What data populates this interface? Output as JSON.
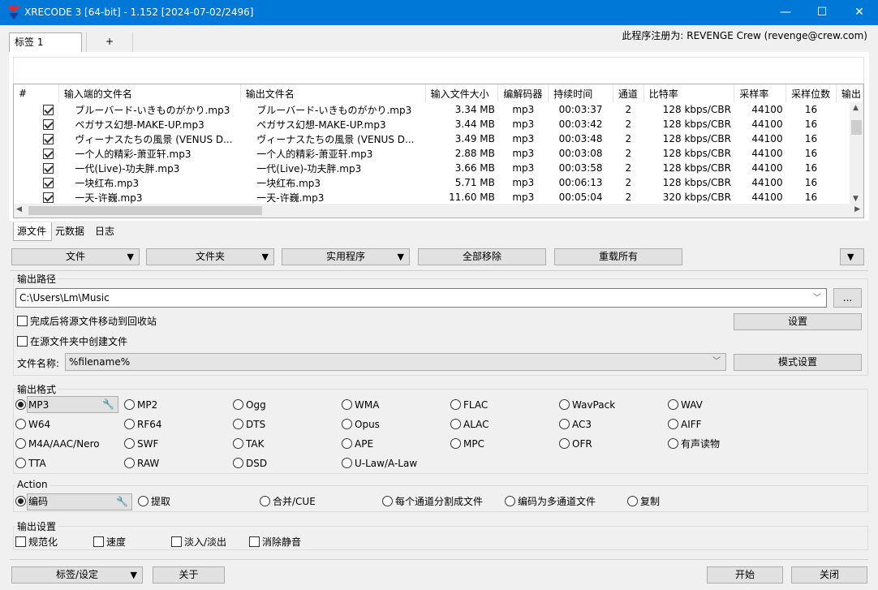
{
  "window": {
    "title": "XRECODE 3 [64-bit] - 1.152 [2024-07-02/2496]",
    "minimize": "—",
    "maximize": "☐",
    "close": "✕"
  },
  "top_tabs": {
    "tab1": "标签 1",
    "add": "+"
  },
  "registration": "此程序注册为: REVENGE Crew (revenge@crew.com)",
  "file_list": {
    "columns": [
      "#",
      "输入端的文件名",
      "输出文件名",
      "输入文件大小",
      "编解码器",
      "持续时间",
      "通道",
      "比特率",
      "采样率",
      "采样位数",
      "输出"
    ],
    "rows": [
      {
        "in": "ブルーバード-いきものがかり.mp3",
        "out": "ブルーバード-いきものがかり.mp3",
        "size": "3.34 MB",
        "codec": "mp3",
        "dur": "00:03:37",
        "ch": "2",
        "br": "128 kbps/CBR",
        "sr": "44100",
        "bits": "16"
      },
      {
        "in": "ペガサス幻想-MAKE-UP.mp3",
        "out": "ペガサス幻想-MAKE-UP.mp3",
        "size": "3.44 MB",
        "codec": "mp3",
        "dur": "00:03:42",
        "ch": "2",
        "br": "128 kbps/CBR",
        "sr": "44100",
        "bits": "16"
      },
      {
        "in": "ヴィーナスたちの風景 (VENUS D...",
        "out": "ヴィーナスたちの風景 (VENUS D...",
        "size": "3.49 MB",
        "codec": "mp3",
        "dur": "00:03:48",
        "ch": "2",
        "br": "128 kbps/CBR",
        "sr": "44100",
        "bits": "16"
      },
      {
        "in": "一个人的精彩-萧亚轩.mp3",
        "out": "一个人的精彩-萧亚轩.mp3",
        "size": "2.88 MB",
        "codec": "mp3",
        "dur": "00:03:08",
        "ch": "2",
        "br": "128 kbps/CBR",
        "sr": "44100",
        "bits": "16"
      },
      {
        "in": "一代(Live)-功夫胖.mp3",
        "out": "一代(Live)-功夫胖.mp3",
        "size": "3.66 MB",
        "codec": "mp3",
        "dur": "00:03:58",
        "ch": "2",
        "br": "128 kbps/CBR",
        "sr": "44100",
        "bits": "16"
      },
      {
        "in": "一块红布.mp3",
        "out": "一块红布.mp3",
        "size": "5.71 MB",
        "codec": "mp3",
        "dur": "00:06:13",
        "ch": "2",
        "br": "128 kbps/CBR",
        "sr": "44100",
        "bits": "16"
      },
      {
        "in": "一天-许巍.mp3",
        "out": "一天-许巍.mp3",
        "size": "11.60 MB",
        "codec": "mp3",
        "dur": "00:05:04",
        "ch": "2",
        "br": "320 kbps/CBR",
        "sr": "44100",
        "bits": "16"
      }
    ]
  },
  "bottom_tabs": [
    "源文件",
    "元数据",
    "日志"
  ],
  "toolbar": {
    "file": "文件",
    "folder": "文件夹",
    "utility": "实用程序",
    "remove_all": "全部移除",
    "reload_all": "重载所有"
  },
  "output_path": {
    "label": "输出路径",
    "value": "C:\\Users\\Lm\\Music",
    "browse": "...",
    "move_to_recycle": "完成后将源文件移动到回收站",
    "settings": "设置",
    "create_in_source": "在源文件夹中创建文件",
    "filename_label": "文件名称:",
    "filename_value": "%filename%",
    "pattern_settings": "模式设置"
  },
  "output_format": {
    "label": "输出格式",
    "selected": "MP3",
    "options": [
      [
        "MP3",
        "MP2",
        "Ogg",
        "WMA",
        "FLAC",
        "WavPack",
        "WAV"
      ],
      [
        "W64",
        "RF64",
        "DTS",
        "Opus",
        "ALAC",
        "AC3",
        "AIFF"
      ],
      [
        "M4A/AAC/Nero",
        "SWF",
        "TAK",
        "APE",
        "MPC",
        "OFR",
        "有声读物"
      ],
      [
        "TTA",
        "RAW",
        "DSD",
        "U-Law/A-Law"
      ]
    ]
  },
  "action": {
    "label": "Action",
    "selected": "编码",
    "options": [
      "编码",
      "提取",
      "合并/CUE",
      "每个通道分割成文件",
      "编码为多通道文件",
      "复制"
    ]
  },
  "output_settings": {
    "label": "输出设置",
    "options": [
      "规范化",
      "速度",
      "淡入/淡出",
      "消除静音"
    ]
  },
  "footer": {
    "tags_settings": "标签/设定",
    "about": "关于",
    "start": "开始",
    "close": "关闭"
  },
  "colors": {
    "titlebar": "#0078d7",
    "background": "#f0f0f0"
  }
}
